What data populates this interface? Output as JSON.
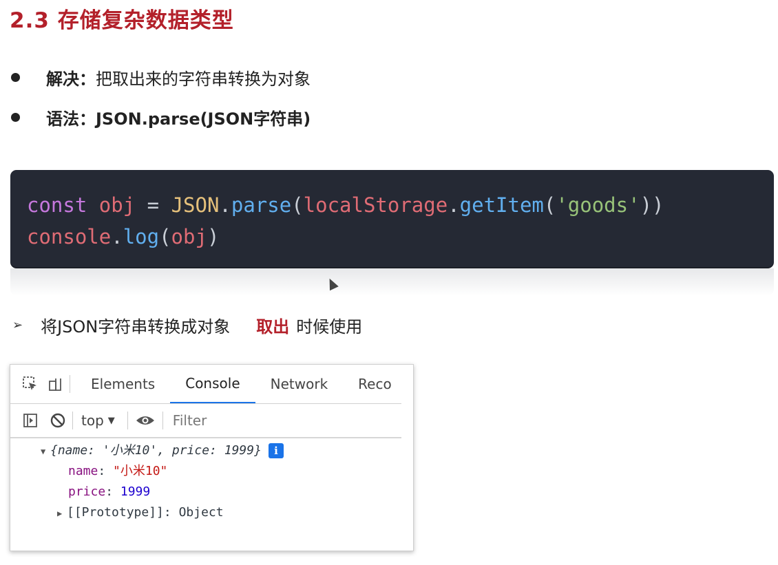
{
  "slide": {
    "title": "2.3 存储复杂数据类型",
    "bullets": [
      {
        "label": "解决：",
        "text": "把取出来的字符串转换为对象"
      },
      {
        "label": "语法：JSON.parse(JSON字符串)",
        "text": ""
      }
    ],
    "code": {
      "line1": {
        "kw": "const",
        "var": "obj",
        "op": "=",
        "obj": "JSON",
        "fn": "parse",
        "arg_obj": "localStorage",
        "arg_fn": "getItem",
        "str": "'goods'"
      },
      "line2": {
        "obj": "console",
        "fn": "log",
        "arg": "obj"
      }
    },
    "note": {
      "text": "将JSON字符串转换成对象",
      "highlight": "取出",
      "suffix": "时候使用"
    }
  },
  "devtools": {
    "tabs": [
      "Elements",
      "Console",
      "Network",
      "Reco"
    ],
    "active_tab": "Console",
    "context": "top",
    "filter_placeholder": "Filter",
    "console": {
      "preview": "{name: '小米10', price: 1999}",
      "props": [
        {
          "key": "name",
          "value": "\"小米10\""
        },
        {
          "key": "price",
          "value": "1999"
        }
      ],
      "prototype_key": "[[Prototype]]",
      "prototype_value": "Object"
    }
  },
  "colors": {
    "title_red": "#b3202a",
    "code_bg": "#252934",
    "devtools_accent": "#1a73e8"
  },
  "icons": [
    "inspect-element-icon",
    "device-toggle-icon",
    "sidebar-toggle-icon",
    "clear-console-icon",
    "eye-icon",
    "info-icon",
    "mouse-cursor-icon"
  ]
}
